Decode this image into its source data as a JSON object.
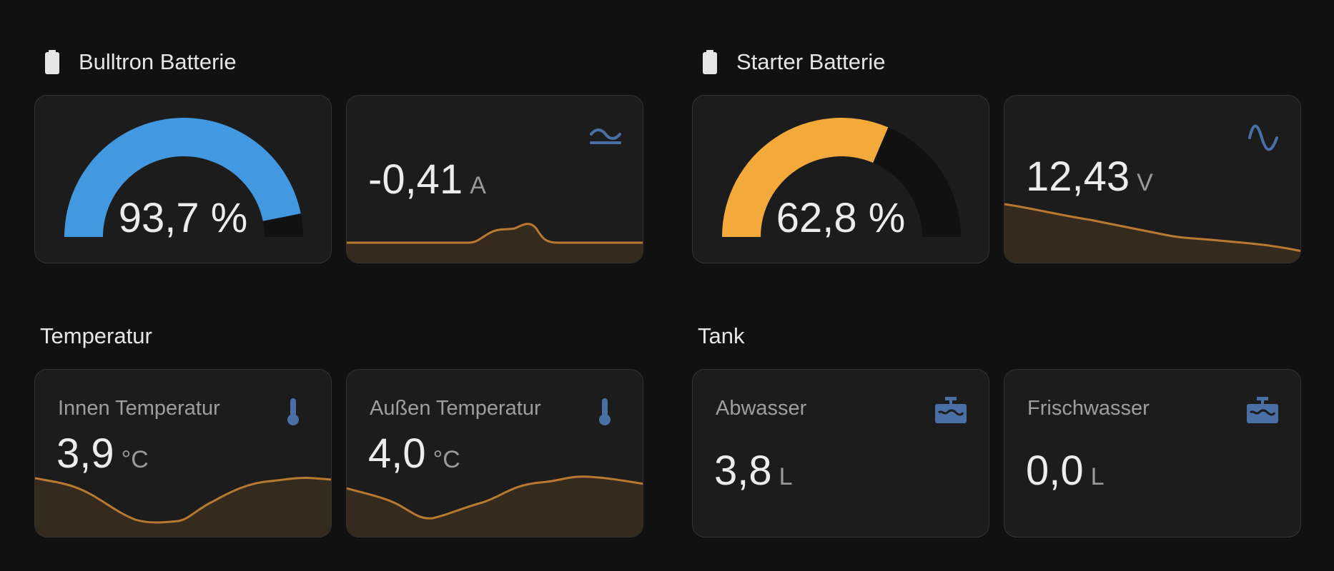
{
  "sections": {
    "bulltron": {
      "title": "Bulltron Batterie",
      "icon": "battery-icon"
    },
    "starter": {
      "title": "Starter Batterie",
      "icon": "battery-icon"
    },
    "temperatur": {
      "title": "Temperatur"
    },
    "tank": {
      "title": "Tank"
    }
  },
  "cards": {
    "bulltron_soc": {
      "value": "93,7 %",
      "level": 0.937,
      "color": "#4299e1"
    },
    "bulltron_current": {
      "value": "-0,41",
      "unit": "A",
      "icon": "current-ac-icon"
    },
    "starter_soc": {
      "value": "62,8 %",
      "level": 0.628,
      "color": "#f4a93b"
    },
    "starter_voltage": {
      "value": "12,43",
      "unit": "V",
      "icon": "sine-wave-icon"
    },
    "innen_temp": {
      "name": "Innen Temperatur",
      "value": "3,9",
      "unit": "°C",
      "icon": "thermometer-icon"
    },
    "aussen_temp": {
      "name": "Außen Temperatur",
      "value": "4,0",
      "unit": "°C",
      "icon": "thermometer-icon"
    },
    "abwasser": {
      "name": "Abwasser",
      "value": "3,8",
      "unit": "L",
      "icon": "water-tank-icon"
    },
    "frischwasser": {
      "name": "Frischwasser",
      "value": "0,0",
      "unit": "L",
      "icon": "water-tank-icon"
    }
  },
  "colors": {
    "background": "#111111",
    "card": "#1c1c1c",
    "icon": "#4a6fa5",
    "graph_line": "#b87a30",
    "graph_fill": "#352a1e",
    "gauge_track": "#111111"
  }
}
